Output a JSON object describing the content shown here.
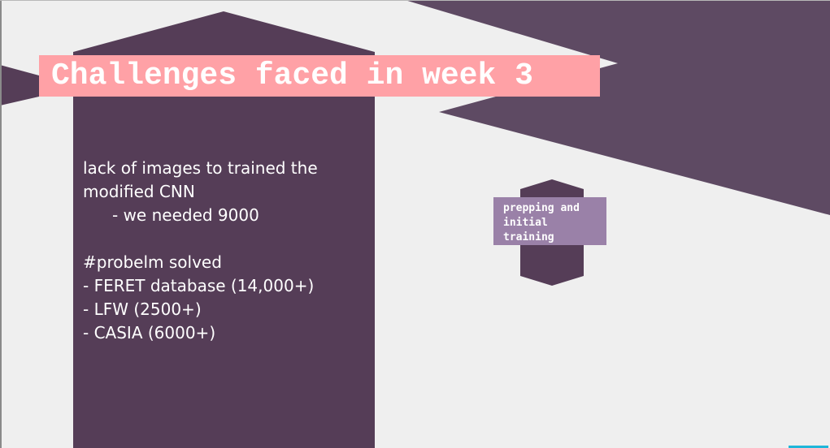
{
  "slide": {
    "title": "Challenges faced in week 3",
    "body": {
      "problem_lines": [
        "lack of images to trained the",
        "modified CNN"
      ],
      "sub_point": "- we needed 9000",
      "solved_heading": "#probelm solved",
      "solutions": [
        "- FERET database (14,000+)",
        "- LFW (2500+)",
        "- CASIA (6000+)"
      ]
    },
    "badge": {
      "lines": [
        "prepping and",
        "initial",
        "training"
      ]
    }
  },
  "colors": {
    "background": "#efefef",
    "dark_purple": "#553d57",
    "mid_purple": "#5e4a63",
    "title_pink": "#ffa1a6",
    "badge_lilac": "#9a81a8",
    "text_white": "#ffffff"
  }
}
